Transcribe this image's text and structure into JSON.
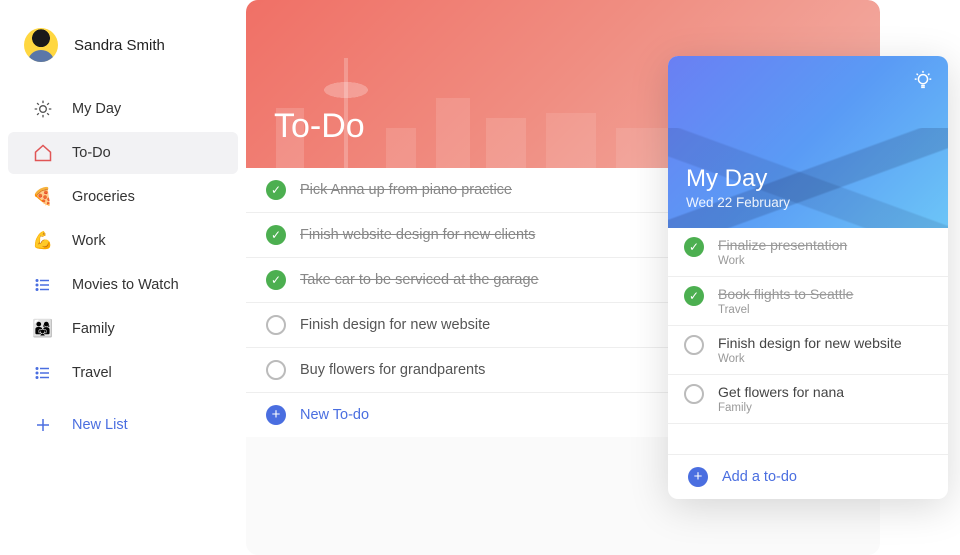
{
  "user": {
    "name": "Sandra Smith"
  },
  "sidebar": {
    "items": [
      {
        "label": "My Day",
        "name": "myday",
        "icon": "sun"
      },
      {
        "label": "To-Do",
        "name": "todo",
        "icon": "home",
        "active": true
      },
      {
        "label": "Groceries",
        "name": "groceries",
        "icon": "pizza"
      },
      {
        "label": "Work",
        "name": "work",
        "icon": "flex"
      },
      {
        "label": "Movies to Watch",
        "name": "movies",
        "icon": "list"
      },
      {
        "label": "Family",
        "name": "family",
        "icon": "people"
      },
      {
        "label": "Travel",
        "name": "travel",
        "icon": "list"
      }
    ],
    "new_list_label": "New List"
  },
  "main": {
    "title": "To-Do",
    "tasks": [
      {
        "text": "Pick Anna up from piano practice",
        "done": true
      },
      {
        "text": "Finish website design for new clients",
        "done": true
      },
      {
        "text": "Take car to be serviced at the garage",
        "done": true
      },
      {
        "text": "Finish design for new website",
        "done": false
      },
      {
        "text": "Buy flowers for grandparents",
        "done": false
      }
    ],
    "add_label": "New To-do"
  },
  "myday": {
    "title": "My Day",
    "date": "Wed 22 February",
    "tasks": [
      {
        "text": "Finalize presentation",
        "sub": "Work",
        "done": true
      },
      {
        "text": "Book flights to Seattle",
        "sub": "Travel",
        "done": true
      },
      {
        "text": "Finish design for new website",
        "sub": "Work",
        "done": false
      },
      {
        "text": "Get flowers for nana",
        "sub": "Family",
        "done": false
      }
    ],
    "add_label": "Add a to-do"
  },
  "colors": {
    "accent": "#4a6ee0",
    "success": "#4caf50"
  }
}
